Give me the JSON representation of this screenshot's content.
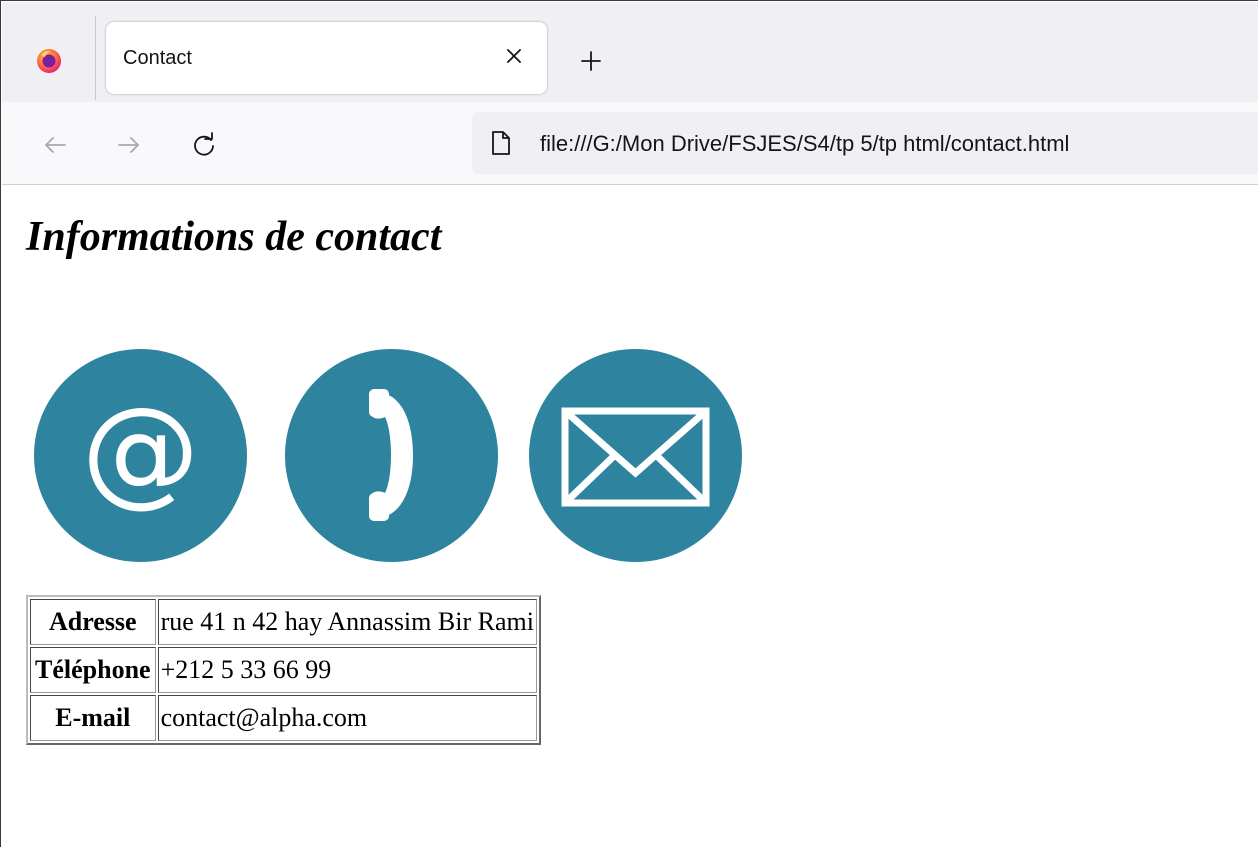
{
  "browser": {
    "tab_title": "Contact",
    "url": "file:///G:/Mon Drive/FSJES/S4/tp 5/tp html/contact.html",
    "icons": {
      "logo": "firefox-logo-icon",
      "tab_close": "close-icon",
      "new_tab": "plus-icon",
      "back": "back-arrow-icon",
      "forward": "forward-arrow-icon",
      "reload": "reload-icon",
      "page": "page-icon"
    }
  },
  "page": {
    "heading": "Informations de contact",
    "icons": [
      "at-sign-icon",
      "telephone-icon",
      "envelope-icon"
    ],
    "icon_color": "#2e849e",
    "table": {
      "rows": [
        {
          "label": "Adresse",
          "value": "rue 41 n 42 hay Annassim Bir Rami"
        },
        {
          "label": "Téléphone",
          "value": "+212 5 33 66 99"
        },
        {
          "label": "E-mail",
          "value": "contact@alpha.com"
        }
      ]
    }
  }
}
